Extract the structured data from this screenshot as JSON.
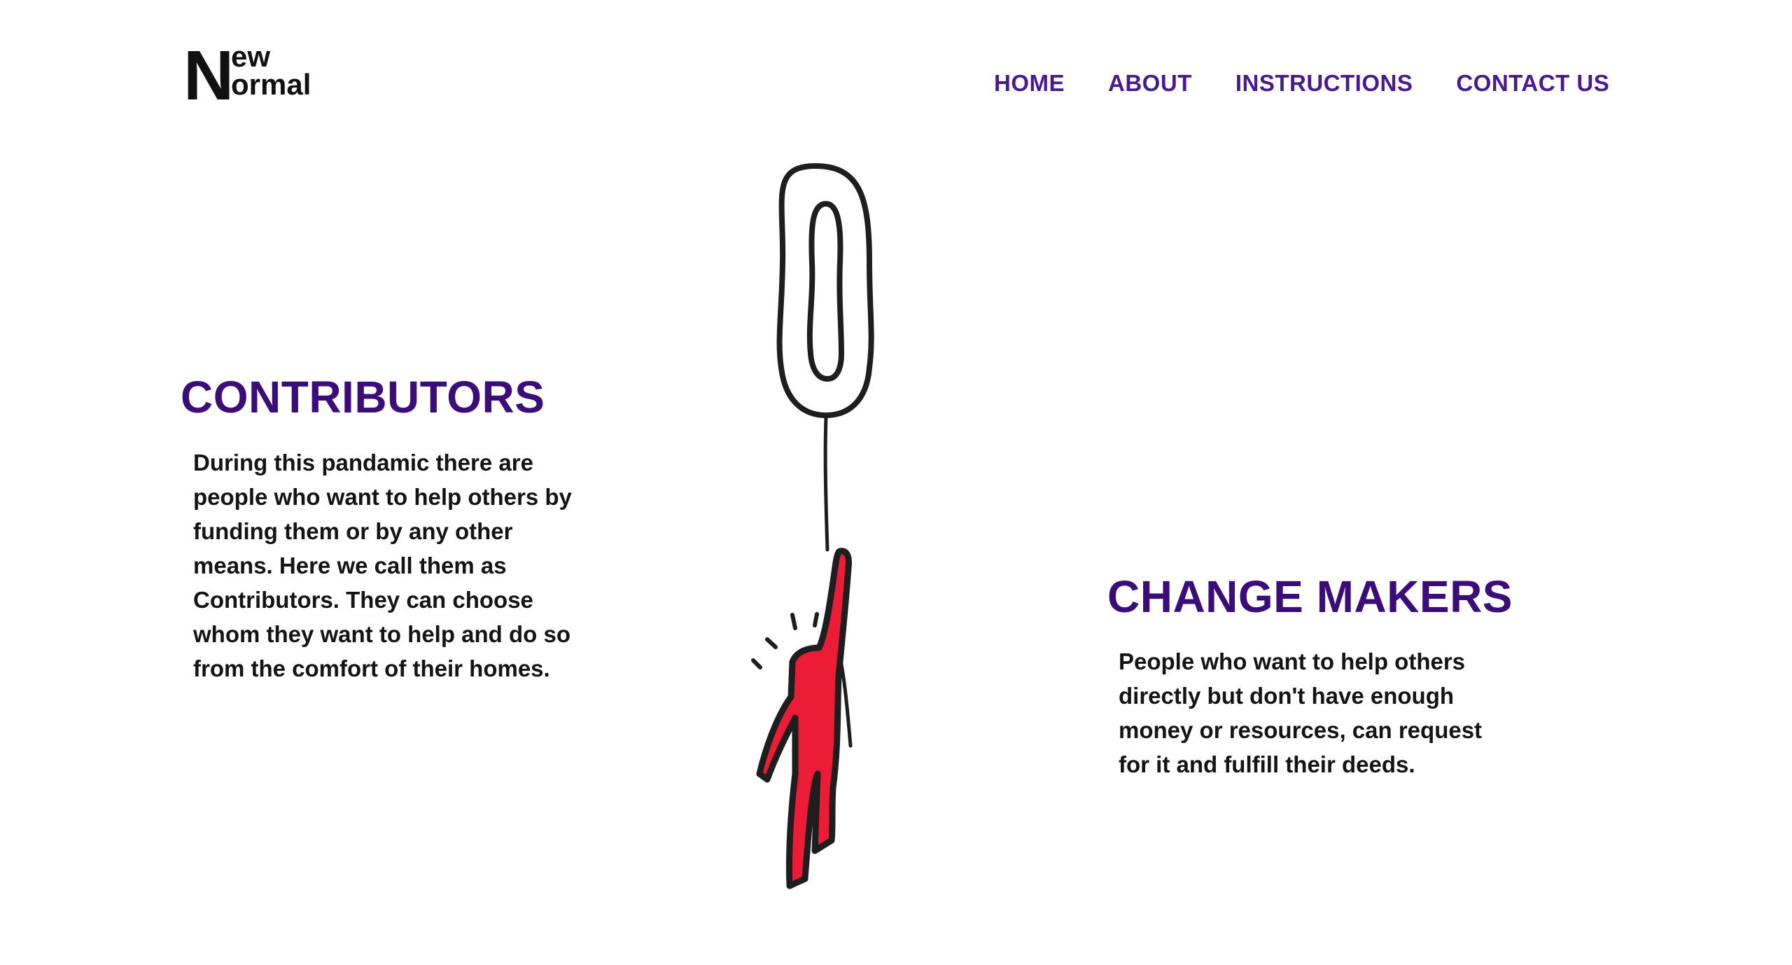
{
  "logo": {
    "big_letter": "N",
    "line1": "ew",
    "line2": "ormal"
  },
  "nav": {
    "items": [
      {
        "label": "HOME"
      },
      {
        "label": "ABOUT"
      },
      {
        "label": "INSTRUCTIONS"
      },
      {
        "label": "CONTACT US"
      }
    ]
  },
  "contributors": {
    "title": "CONTRIBUTORS",
    "body": "During this pandamic there are people who want to help others by funding them or by any other means. Here we call them as Contributors. They can choose whom they want to help and do so from the comfort of their homes."
  },
  "change_makers": {
    "title": "CHANGE MAKERS",
    "body": "People who want to help others directly but don't have enough money or resources, can request for it and fulfill their deeds."
  },
  "illustration": {
    "name": "balloon-person-illustration",
    "figure_color": "#ec1c36",
    "outline_color": "#1e1e1e"
  },
  "colors": {
    "nav": "#4a1890",
    "heading": "#3a0d7a",
    "text": "#141414",
    "background": "#ffffff"
  }
}
